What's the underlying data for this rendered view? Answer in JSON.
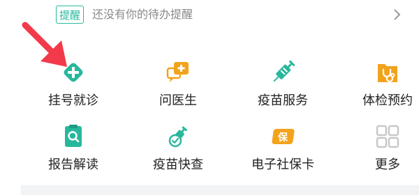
{
  "reminder": {
    "badge": "提醒",
    "text": "还没有你的待办提醒"
  },
  "services": [
    {
      "label": "挂号就诊",
      "icon": "medical-plus-icon"
    },
    {
      "label": "问医生",
      "icon": "chat-plus-icon"
    },
    {
      "label": "疫苗服务",
      "icon": "syringe-icon"
    },
    {
      "label": "体检预约",
      "icon": "stethoscope-folder-icon"
    },
    {
      "label": "报告解读",
      "icon": "report-search-icon"
    },
    {
      "label": "疫苗快查",
      "icon": "vaccine-check-icon"
    },
    {
      "label": "电子社保卡",
      "icon": "social-security-card-icon"
    },
    {
      "label": "更多",
      "icon": "more-grid-icon"
    }
  ],
  "colors": {
    "accent_green": "#27b89c",
    "accent_orange": "#f2a31b",
    "arrow_red": "#f23a4a",
    "muted_text": "#8a8a8a",
    "more_gray": "#c8c8c8"
  }
}
